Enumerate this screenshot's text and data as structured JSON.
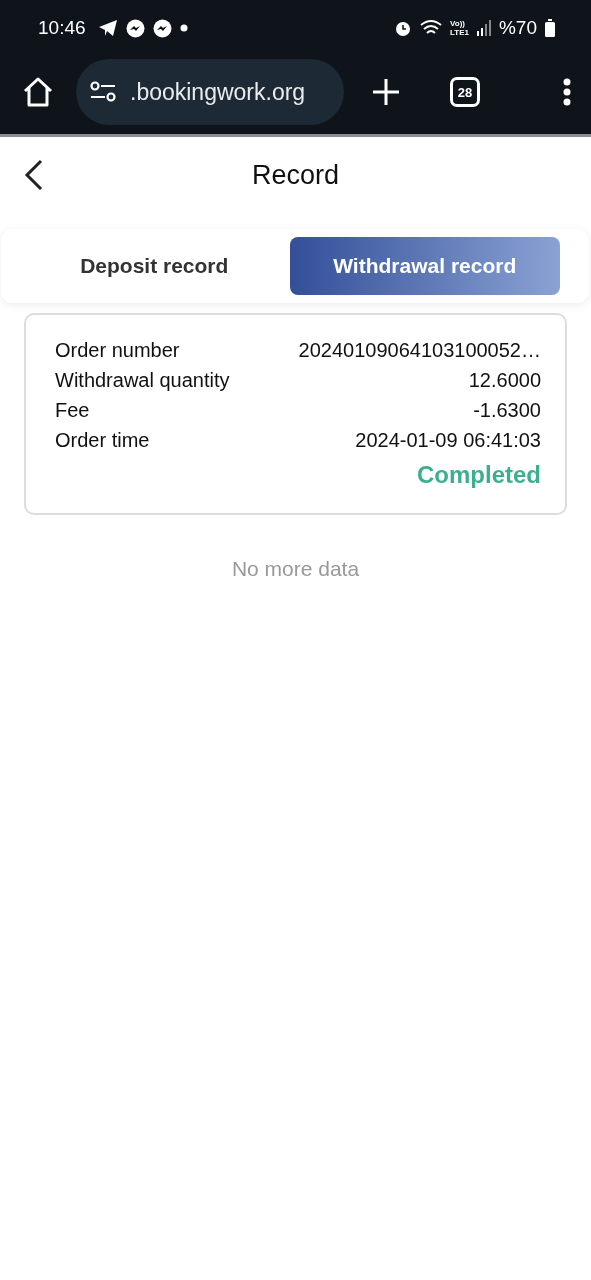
{
  "status_bar": {
    "time": "10:46",
    "network_label_top": "Vo))",
    "network_label_bottom": "LTE1",
    "battery": "%70"
  },
  "browser": {
    "url": ".bookingwork.org",
    "tab_count": "28"
  },
  "header": {
    "title": "Record"
  },
  "tabs": [
    {
      "label": "Deposit record",
      "selected": false
    },
    {
      "label": "Withdrawal record",
      "selected": true
    }
  ],
  "records": [
    {
      "fields": [
        {
          "label": "Order number",
          "value": "20240109064103100052…"
        },
        {
          "label": "Withdrawal quantity",
          "value": "12.6000"
        },
        {
          "label": "Fee",
          "value": "-1.6300"
        },
        {
          "label": "Order time",
          "value": "2024-01-09 06:41:03"
        }
      ],
      "status": "Completed",
      "color": "#3bb08f"
    }
  ],
  "footer_note": "No more data"
}
